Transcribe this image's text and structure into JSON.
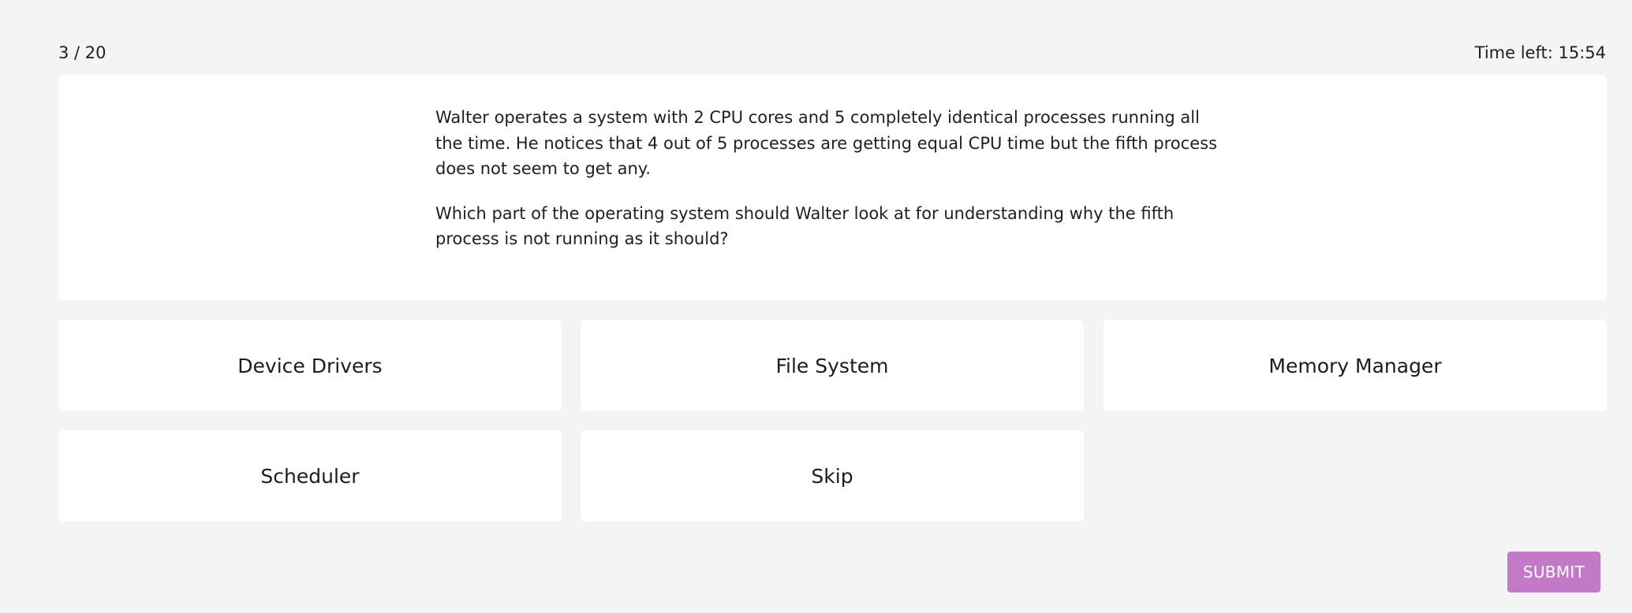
{
  "progress": {
    "label": "3 / 20"
  },
  "timer": {
    "label": "Time left: 15:54"
  },
  "question": {
    "paragraphs": [
      "Walter operates a system with 2 CPU cores and 5 completely identical processes running all the time. He notices that 4 out of 5 processes are getting equal CPU time but the fifth process does not seem to get any.",
      "Which part of the operating system should Walter look at for understanding why the fifth process is not running as it should?"
    ]
  },
  "options": [
    {
      "label": "Device Drivers"
    },
    {
      "label": "File System"
    },
    {
      "label": "Memory Manager"
    },
    {
      "label": "Scheduler"
    },
    {
      "label": "Skip"
    }
  ],
  "submit": {
    "label": "SUBMIT",
    "color": "#c27ac8"
  }
}
